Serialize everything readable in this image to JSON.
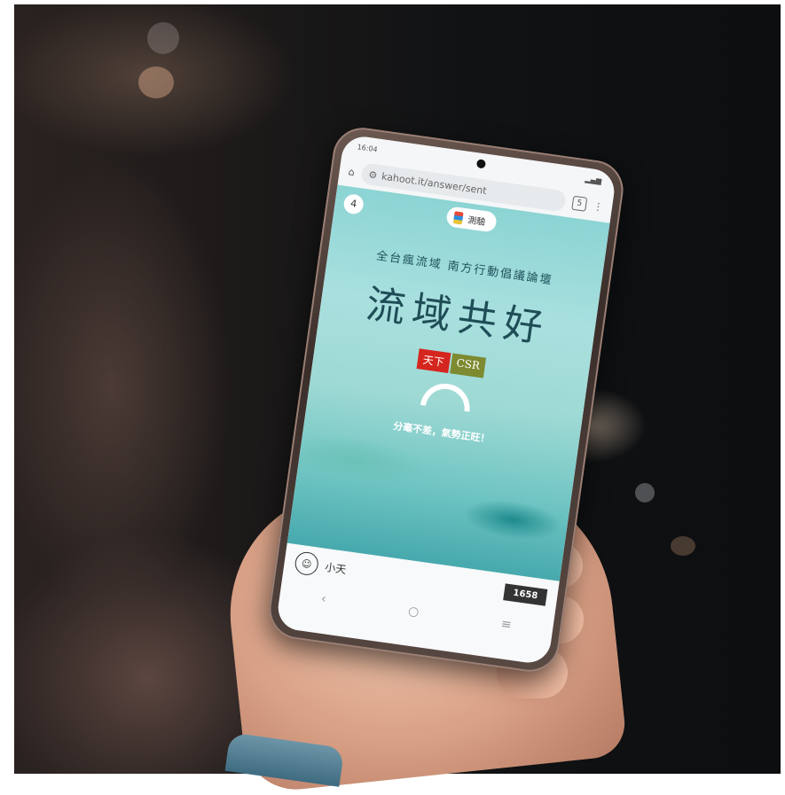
{
  "status_bar": {
    "time": "16:04"
  },
  "browser": {
    "url": "kahoot.it/answer/sent",
    "tab_count": "5",
    "home_icon": "home-icon",
    "menu_icon": "kebab-menu-icon"
  },
  "quiz": {
    "question_number": "4",
    "badge_label": "測驗"
  },
  "banner": {
    "forum_title": "全台瘋流域 南方行動倡議論壇",
    "main_title": "流域共好",
    "logo_left": "天下",
    "logo_right": "CSR"
  },
  "status_message": "分毫不差，氣勢正旺！",
  "player": {
    "name": "小天",
    "score": "1658"
  },
  "nav": {
    "back": "‹",
    "home": "○",
    "recents": "≡"
  }
}
